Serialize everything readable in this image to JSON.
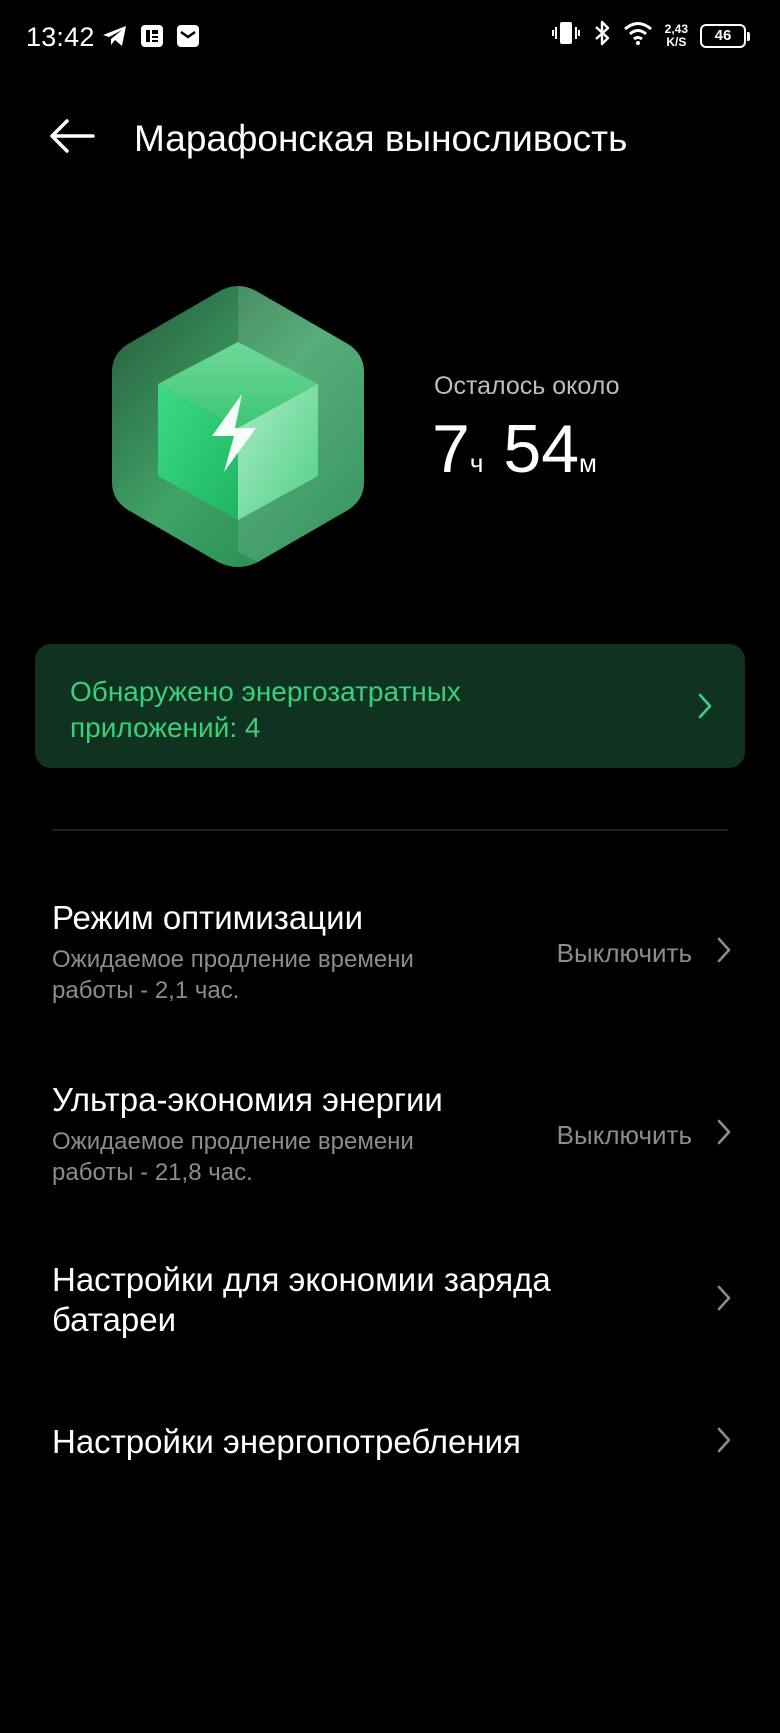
{
  "status_bar": {
    "time": "13:42",
    "left_icons": [
      "telegram-icon",
      "news-app-icon",
      "mail-icon"
    ],
    "right_icons": [
      "vibrate-icon",
      "bluetooth-icon",
      "wifi-icon"
    ],
    "net_speed_value": "2,43",
    "net_speed_unit": "K/S",
    "battery_level": "46"
  },
  "header": {
    "back_icon": "arrow-left-icon",
    "title": "Марафонская выносливость"
  },
  "hero": {
    "icon": "battery-cube-bolt-icon",
    "accent_color": "#3ddc84",
    "remaining_label": "Осталось около",
    "hours": "7",
    "hours_unit": "ч",
    "minutes": "54",
    "minutes_unit": "м"
  },
  "banner": {
    "text": "Обнаружено энергозатратных приложений: 4",
    "text_color": "#3bd17a",
    "background": "#0f3320"
  },
  "items": [
    {
      "title": "Режим оптимизации",
      "subtitle": "Ожидаемое продление времени работы - 2,1 час.",
      "value": "Выключить"
    },
    {
      "title": "Ультра-экономия энергии",
      "subtitle": "Ожидаемое продление времени работы - 21,8 час.",
      "value": "Выключить"
    },
    {
      "title": "Настройки для экономии заряда батареи"
    },
    {
      "title": "Настройки энергопотребления"
    }
  ]
}
